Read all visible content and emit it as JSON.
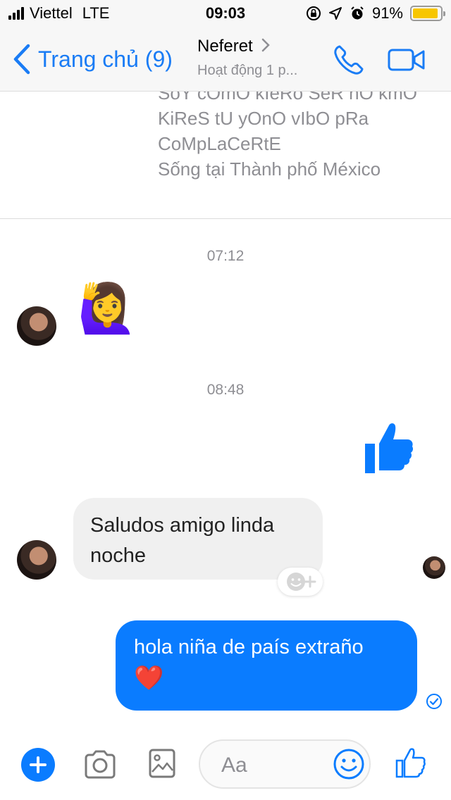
{
  "status_bar": {
    "carrier": "Viettel",
    "network": "LTE",
    "time": "09:03",
    "battery_percent": "91%",
    "battery_level": 0.91
  },
  "header": {
    "back_label": "Trang chủ (9)",
    "contact_name": "Neferet",
    "activity_status": "Hoạt động 1 p...",
    "icons": {
      "back": "chevron-left-icon",
      "call": "phone-icon",
      "video": "video-camera-icon",
      "details": "chevron-right-icon"
    },
    "accent_color": "#1a7cf5"
  },
  "profile_bio": {
    "lines": [
      "SoY cOmO kIeRo SeR nO kmO",
      "KiReS tU yOnO vIbO pRa",
      "CoMpLaCeRtE",
      "Sống tại Thành phố México"
    ]
  },
  "conversation": {
    "timestamps": [
      "07:12",
      "08:48"
    ],
    "messages": [
      {
        "sender": "contact",
        "type": "emoji",
        "content": "🙋‍♀️"
      },
      {
        "sender": "me",
        "type": "like",
        "content": "thumbs-up-icon"
      },
      {
        "sender": "contact",
        "type": "text",
        "content": "Saludos amigo linda noche"
      },
      {
        "sender": "me",
        "type": "text",
        "content": "hola niña de país extraño",
        "emoji": "❤️"
      }
    ],
    "bubble_colors": {
      "incoming": "#f0f0f0",
      "outgoing": "#0a7cff"
    }
  },
  "composer": {
    "placeholder": "Aa",
    "icons": [
      "plus-icon",
      "camera-icon",
      "image-icon",
      "smiley-icon",
      "thumbs-up-icon"
    ]
  }
}
